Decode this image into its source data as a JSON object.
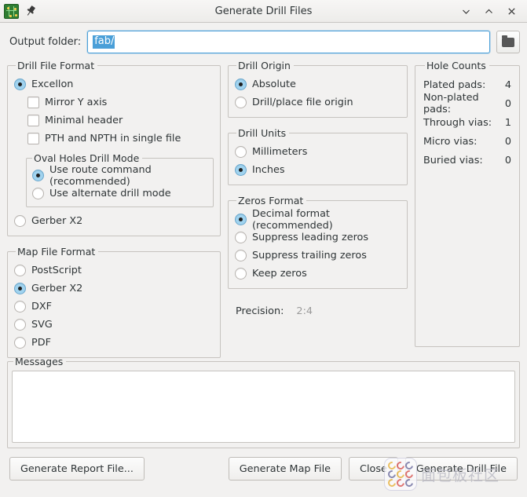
{
  "window": {
    "title": "Generate Drill Files",
    "icons": {
      "app": "pcb-icon",
      "pin": "pin-icon"
    },
    "controls": {
      "minimize": "chevron-down-icon",
      "maximize": "chevron-up-icon",
      "close": "close-icon"
    }
  },
  "output": {
    "label": "Output folder:",
    "value": "fab/",
    "placeholder": "",
    "browse_icon": "folder-icon"
  },
  "drill_file_format": {
    "legend": "Drill File Format",
    "options": [
      {
        "label": "Excellon",
        "selected": true
      },
      {
        "label": "Gerber X2",
        "selected": false
      }
    ],
    "checkboxes": [
      {
        "label": "Mirror Y axis",
        "checked": false
      },
      {
        "label": "Minimal header",
        "checked": false
      },
      {
        "label": "PTH and NPTH in single file",
        "checked": false
      }
    ],
    "oval_holes": {
      "legend": "Oval Holes Drill Mode",
      "options": [
        {
          "label": "Use route command (recommended)",
          "selected": true
        },
        {
          "label": "Use alternate drill mode",
          "selected": false
        }
      ]
    }
  },
  "map_file_format": {
    "legend": "Map File Format",
    "options": [
      {
        "label": "PostScript",
        "selected": false
      },
      {
        "label": "Gerber X2",
        "selected": true
      },
      {
        "label": "DXF",
        "selected": false
      },
      {
        "label": "SVG",
        "selected": false
      },
      {
        "label": "PDF",
        "selected": false
      }
    ]
  },
  "drill_origin": {
    "legend": "Drill Origin",
    "options": [
      {
        "label": "Absolute",
        "selected": true
      },
      {
        "label": "Drill/place file origin",
        "selected": false
      }
    ]
  },
  "drill_units": {
    "legend": "Drill Units",
    "options": [
      {
        "label": "Millimeters",
        "selected": false
      },
      {
        "label": "Inches",
        "selected": true
      }
    ]
  },
  "zeros_format": {
    "legend": "Zeros Format",
    "options": [
      {
        "label": "Decimal format (recommended)",
        "selected": true
      },
      {
        "label": "Suppress leading zeros",
        "selected": false
      },
      {
        "label": "Suppress trailing zeros",
        "selected": false
      },
      {
        "label": "Keep zeros",
        "selected": false
      }
    ]
  },
  "precision": {
    "label": "Precision:",
    "value": "2:4"
  },
  "hole_counts": {
    "legend": "Hole Counts",
    "rows": [
      {
        "label": "Plated pads:",
        "value": "4"
      },
      {
        "label": "Non-plated pads:",
        "value": "0"
      },
      {
        "label": "Through vias:",
        "value": "1"
      },
      {
        "label": "Micro vias:",
        "value": "0"
      },
      {
        "label": "Buried vias:",
        "value": "0"
      }
    ]
  },
  "messages": {
    "legend": "Messages",
    "content": ""
  },
  "buttons": {
    "report": "Generate Report File...",
    "map": "Generate Map File",
    "close": "Close",
    "drill": "Generate Drill File"
  },
  "watermark": {
    "text": "面包板社区",
    "logo": "breadboard-community-logo"
  },
  "colors": {
    "accent": "#4a9fd8",
    "radio_selected": "#a0d3ef",
    "window_bg": "#f2f1f0",
    "disabled_text": "#9a9a9a"
  }
}
